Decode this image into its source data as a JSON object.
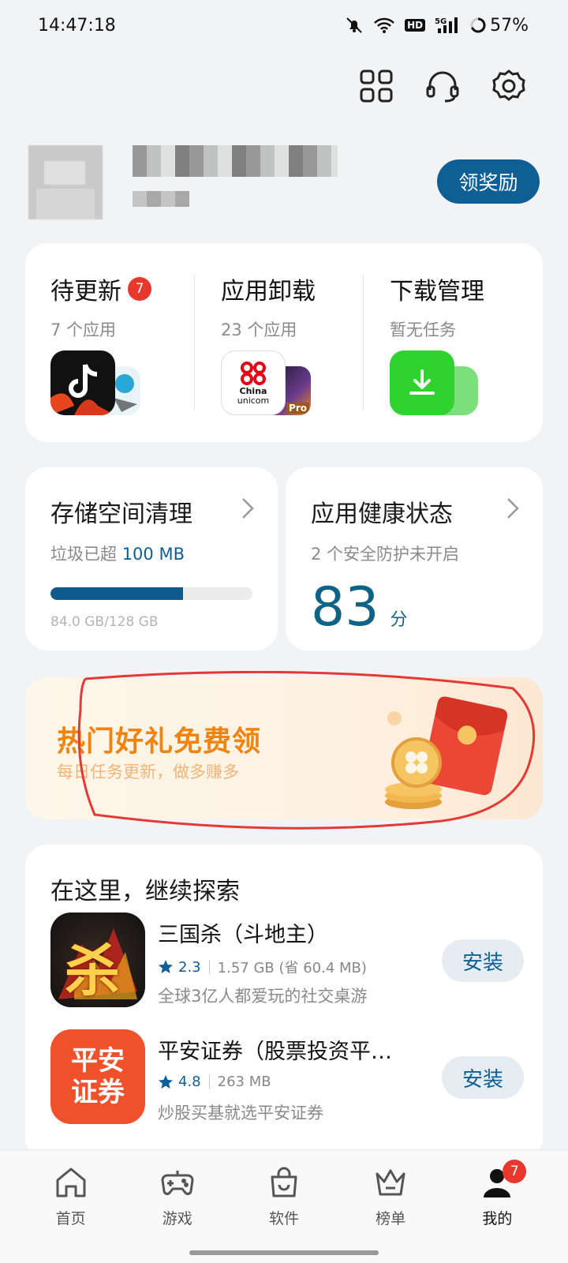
{
  "status_bar": {
    "time": "14:47:18",
    "battery": "57%"
  },
  "header": {
    "reward_label": "领奖励"
  },
  "quick": {
    "pending": {
      "title": "待更新",
      "badge": "7",
      "sub": "7 个应用"
    },
    "uninstall": {
      "title": "应用卸载",
      "sub": "23 个应用"
    },
    "downloads": {
      "title": "下载管理",
      "sub": "暂无任务"
    },
    "unicom_text_1": "China",
    "unicom_text_2": "unicom",
    "pro_text": "Pro"
  },
  "storage": {
    "title": "存储空间清理",
    "sub_prefix": "垃圾已超 ",
    "sub_value": "100 MB",
    "used_fraction": 0.656,
    "usage_label": "84.0 GB/128 GB"
  },
  "health": {
    "title": "应用健康状态",
    "sub": "2 个安全防护未开启",
    "score": "83",
    "unit": "分"
  },
  "banner": {
    "title": "热门好礼免费领",
    "subtitle": "每日任务更新，做多赚多"
  },
  "explore": {
    "title": "在这里，继续探索",
    "apps": [
      {
        "name": "三国杀（斗地主）",
        "rating": "2.3",
        "size": "1.57 GB (省 60.4 MB)",
        "desc": "全球3亿人都爱玩的社交桌游",
        "button": "安装",
        "icon_text": "杀"
      },
      {
        "name": "平安证券（股票投资平…",
        "rating": "4.8",
        "size": "263 MB",
        "desc": "炒股买基就选平安证券",
        "button": "安装",
        "icon_text_1": "平安",
        "icon_text_2": "证券"
      }
    ]
  },
  "tabs": [
    {
      "label": "首页"
    },
    {
      "label": "游戏"
    },
    {
      "label": "软件"
    },
    {
      "label": "榜单"
    },
    {
      "label": "我的",
      "badge": "7"
    }
  ],
  "colors": {
    "accent": "#0e5f96",
    "badge": "#e8372c",
    "banner_title": "#f0840f",
    "score": "#0f6486"
  }
}
